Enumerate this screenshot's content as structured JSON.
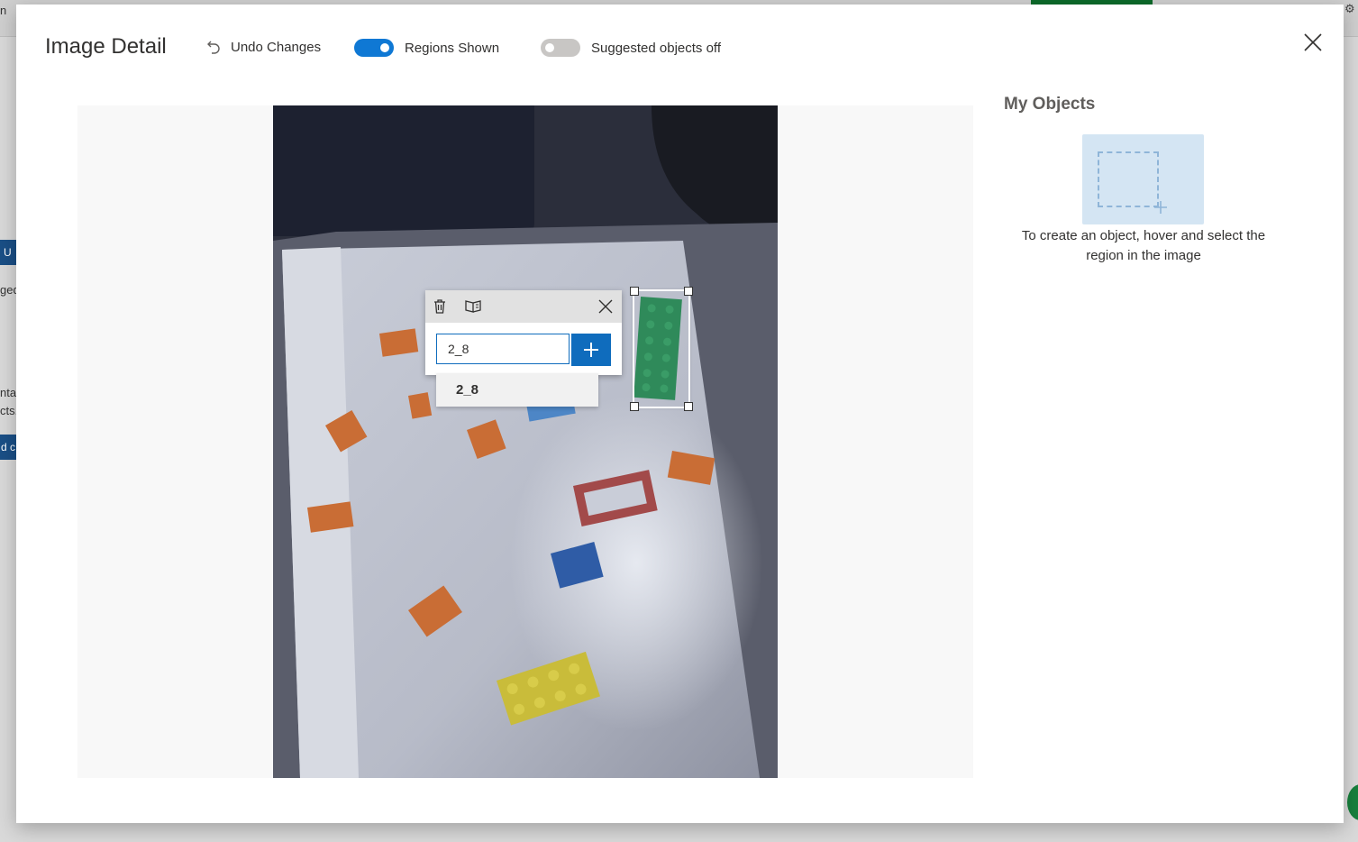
{
  "background": {
    "left_fragments": [
      "n",
      "ged",
      "ntag",
      "cts.",
      "d c",
      "U"
    ],
    "gear_glyph": "⚙"
  },
  "dialog": {
    "title": "Image Detail",
    "toolbar": {
      "undo_label": "Undo Changes",
      "regions_label": "Regions Shown",
      "regions_on": true,
      "suggested_label": "Suggested objects off",
      "suggested_on": false
    },
    "close_icon": "close-icon"
  },
  "editor": {
    "tag_input_value": "2_8",
    "suggestion": "2_8",
    "popup_icons": [
      "delete-icon",
      "swap-icon",
      "close-icon"
    ],
    "add_icon": "plus-icon"
  },
  "objects_panel": {
    "title": "My Objects",
    "hint": "To create an object, hover and select the region in the image"
  },
  "colors": {
    "accent": "#0f6cbd",
    "toggle_on": "#0f78d4",
    "toggle_off": "#c8c6c4",
    "object_card": "#d4e5f3"
  }
}
